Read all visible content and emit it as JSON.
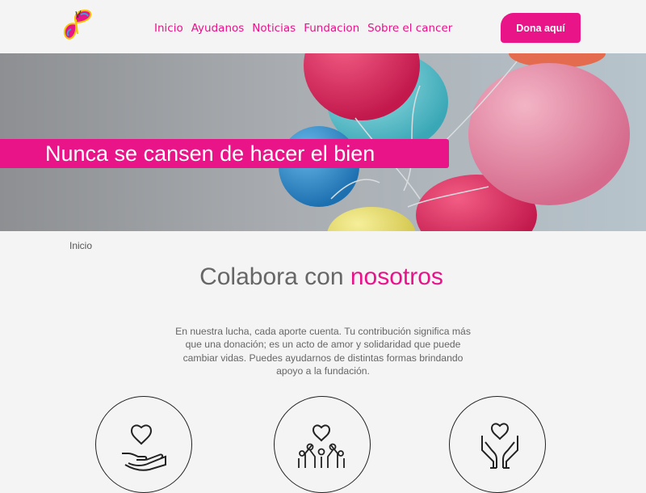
{
  "header": {
    "logo_icon": "butterfly-logo-icon",
    "nav": [
      {
        "label": "Inicio"
      },
      {
        "label": "Ayudanos"
      },
      {
        "label": "Noticias"
      },
      {
        "label": "Fundacion"
      },
      {
        "label": "Sobre el cancer"
      }
    ],
    "donate_label": "Dona aquí"
  },
  "hero": {
    "title": "Nunca se cansen de hacer el bien"
  },
  "breadcrumb": "Inicio",
  "main": {
    "title_prefix": "Colabora con",
    "title_accent": "nosotros",
    "intro": "En nuestra lucha, cada aporte cuenta. Tu contribución significa más que una donación; es un acto de amor y solidaridad que puede cambiar vidas. Puedes ayudarnos de distintas formas brindando apoyo a la fundación."
  },
  "features": [
    {
      "icon": "heart-in-hand-icon"
    },
    {
      "icon": "community-heart-icon"
    },
    {
      "icon": "hands-holding-heart-icon"
    }
  ],
  "colors": {
    "accent": "#e8138a",
    "background": "#f4f4f4",
    "text": "#666666"
  }
}
